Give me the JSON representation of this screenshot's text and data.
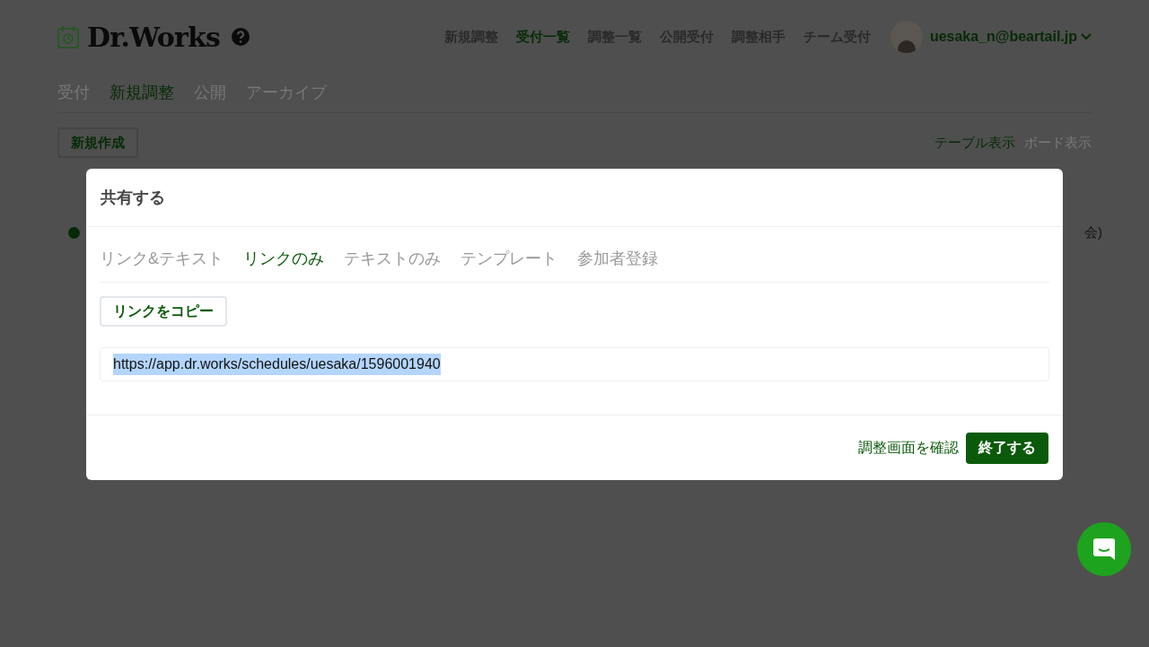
{
  "header": {
    "logo": "Dr.Works",
    "nav": [
      {
        "label": "新規調整",
        "selected": false
      },
      {
        "label": "受付一覧",
        "selected": true
      },
      {
        "label": "調整一覧",
        "selected": false
      },
      {
        "label": "公開受付",
        "selected": false
      },
      {
        "label": "調整相手",
        "selected": false
      },
      {
        "label": "チーム受付",
        "selected": false
      }
    ],
    "user": "uesaka_n@beartail.jp"
  },
  "subtabs": [
    {
      "label": "受付",
      "selected": false
    },
    {
      "label": "新規調整",
      "selected": true
    },
    {
      "label": "公開",
      "selected": false
    },
    {
      "label": "アーカイブ",
      "selected": false
    }
  ],
  "new_button": "新規作成",
  "views": [
    {
      "label": "テーブル表示",
      "selected": true
    },
    {
      "label": "ボード表示",
      "selected": false
    }
  ],
  "row": {
    "color": "#062a06",
    "text_end": "会)"
  },
  "dialog": {
    "title": "共有する",
    "tabs": [
      {
        "label": "リンク&テキスト",
        "selected": false
      },
      {
        "label": "リンクのみ",
        "selected": true
      },
      {
        "label": "テキストのみ",
        "selected": false
      },
      {
        "label": "テンプレート",
        "selected": false
      },
      {
        "label": "参加者登録",
        "selected": false
      }
    ],
    "copy_button": "リンクをコピー",
    "url": "https://app.dr.works/schedules/uesaka/1596001940",
    "url_selected": true,
    "confirm_link": "調整画面を確認",
    "close_button": "終了する"
  }
}
